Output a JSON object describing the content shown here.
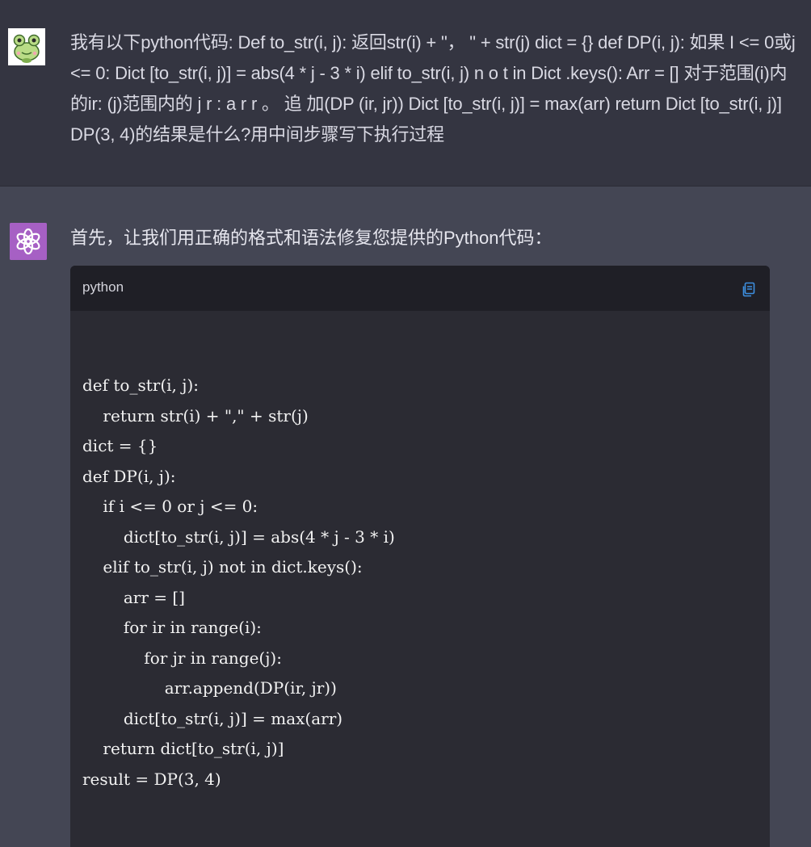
{
  "user_message": {
    "text": "我有以下python代码: Def to_str(i, j): 返回str(i) + \"， \" + str(j) dict = {} def DP(i, j): 如果 I <= 0或j <= 0: Dict [to_str(i, j)] = abs(4 * j - 3 * i) elif to_str(i, j) n o t in Dict .keys(): Arr = [] 对于范围(i)内的ir: (j)范围内的 j r : a r r 。 追 加(DP (ir, jr)) Dict [to_str(i, j)] = max(arr) return Dict [to_str(i, j)] DP(3, 4)的结果是什么?用中间步骤写下执行过程"
  },
  "assistant_message": {
    "intro": "首先，让我们用正确的格式和语法修复您提供的Python代码：",
    "code_block": {
      "language": "python",
      "copy_icon": "copy-icon",
      "lines": [
        "def to_str(i, j):",
        "    return str(i) + \",\" + str(j)",
        "dict = {}",
        "def DP(i, j):",
        "    if i <= 0 or j <= 0:",
        "        dict[to_str(i, j)] = abs(4 * j - 3 * i)",
        "    elif to_str(i, j) not in dict.keys():",
        "        arr = []",
        "        for ir in range(i):",
        "            for jr in range(j):",
        "                arr.append(DP(ir, jr))",
        "        dict[to_str(i, j)] = max(arr)",
        "    return dict[to_str(i, j)]",
        "result = DP(3, 4)"
      ]
    }
  },
  "colors": {
    "user_bg": "#343541",
    "assistant_bg": "#444654",
    "code_bg": "#2b2b33",
    "code_header_bg": "#1f1f26",
    "ai_avatar": "#a660c4",
    "copy_icon": "#3d8fe0"
  }
}
